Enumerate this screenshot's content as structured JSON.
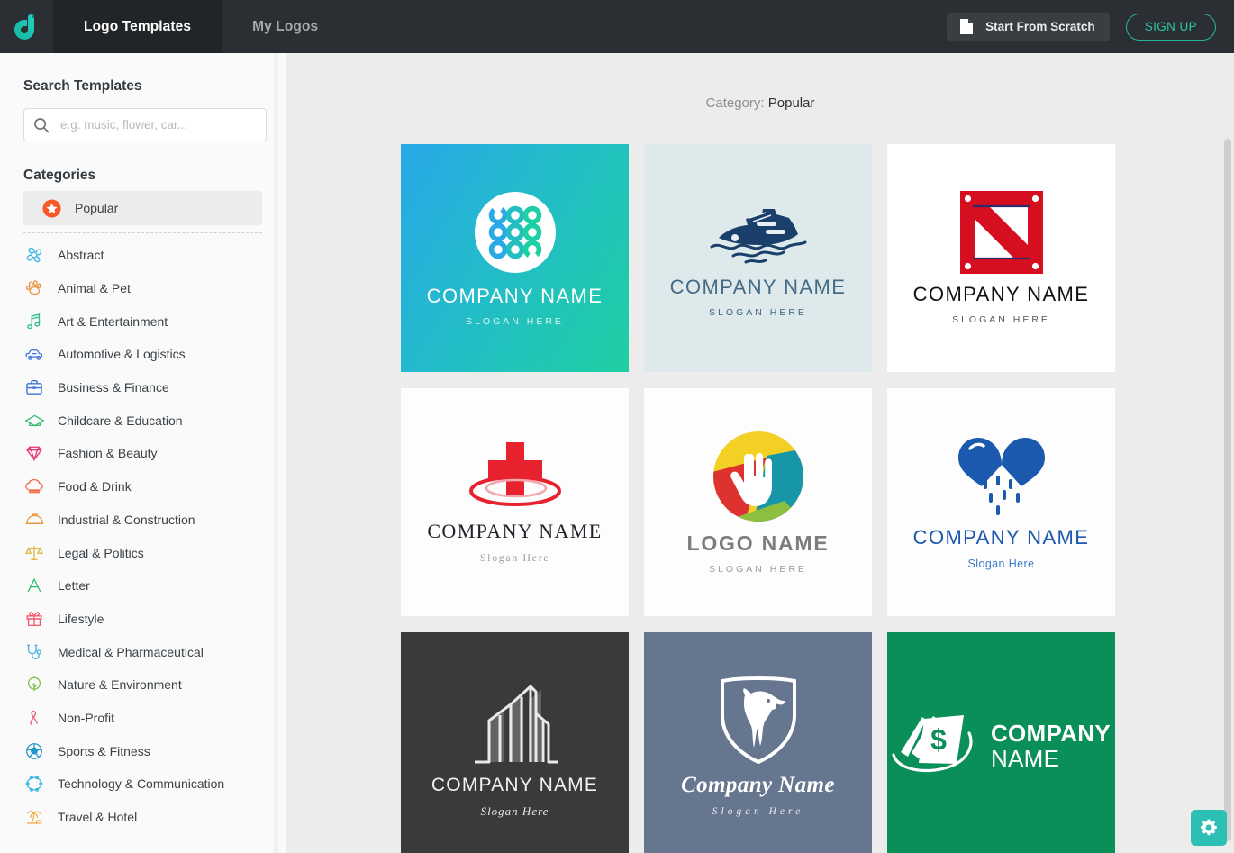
{
  "header": {
    "logo_icon": "brand-d-logo-icon",
    "tabs": [
      {
        "label": "Logo Templates",
        "active": true
      },
      {
        "label": "My Logos",
        "active": false
      }
    ],
    "start_from_scratch": "Start From Scratch",
    "sign_up": "SIGN UP"
  },
  "sidebar": {
    "search_title": "Search Templates",
    "search_placeholder": "e.g. music, flower, car...",
    "search_value": "",
    "categories_title": "Categories",
    "items": [
      {
        "label": "Popular",
        "icon": "star-badge-icon",
        "color": "#f8572a",
        "active": true
      },
      {
        "label": "Abstract",
        "icon": "abstract-swirl-icon",
        "color": "#3fb8e0",
        "active": false
      },
      {
        "label": "Animal & Pet",
        "icon": "paw-icon",
        "color": "#e8933a",
        "active": false
      },
      {
        "label": "Art & Entertainment",
        "icon": "music-note-icon",
        "color": "#2ec28a",
        "active": false
      },
      {
        "label": "Automotive & Logistics",
        "icon": "car-icon",
        "color": "#3c74d8",
        "active": false
      },
      {
        "label": "Business & Finance",
        "icon": "briefcase-icon",
        "color": "#3c74d8",
        "active": false
      },
      {
        "label": "Childcare & Education",
        "icon": "graduation-cap-icon",
        "color": "#2fbd6e",
        "active": false
      },
      {
        "label": "Fashion & Beauty",
        "icon": "diamond-icon",
        "color": "#ea2f73",
        "active": false
      },
      {
        "label": "Food & Drink",
        "icon": "chef-hat-icon",
        "color": "#f2683c",
        "active": false
      },
      {
        "label": "Industrial & Construction",
        "icon": "hard-hat-icon",
        "color": "#e8933a",
        "active": false
      },
      {
        "label": "Legal & Politics",
        "icon": "scales-icon",
        "color": "#e0b53c",
        "active": false
      },
      {
        "label": "Letter",
        "icon": "letter-a-icon",
        "color": "#2fbd6e",
        "active": false
      },
      {
        "label": "Lifestyle",
        "icon": "gift-icon",
        "color": "#f4556a",
        "active": false
      },
      {
        "label": "Medical & Pharmaceutical",
        "icon": "stethoscope-icon",
        "color": "#3fb0e0",
        "active": false
      },
      {
        "label": "Nature & Environment",
        "icon": "tree-icon",
        "color": "#7fc14a",
        "active": false
      },
      {
        "label": "Non-Profit",
        "icon": "ribbon-icon",
        "color": "#ef5d7a",
        "active": false
      },
      {
        "label": "Sports & Fitness",
        "icon": "soccer-ball-icon",
        "color": "#2196c9",
        "active": false
      },
      {
        "label": "Technology & Communication",
        "icon": "tech-hexagon-icon",
        "color": "#3fb8e0",
        "active": false
      },
      {
        "label": "Travel & Hotel",
        "icon": "palm-tree-icon",
        "color": "#f0a93c",
        "active": false
      }
    ]
  },
  "main": {
    "category_label": "Category:",
    "category_value": "Popular",
    "templates": [
      {
        "id": "tpl-dots-circle",
        "mark": "dots-circle-icon",
        "name": "COMPANY NAME",
        "slogan": "SLOGAN HERE",
        "bg": "linear-gradient(120deg,#28a8e8 0%,#23bcc9 45%,#1fcfa2 100%)",
        "name_color": "#ffffff",
        "slogan_color": "#d8f5f2"
      },
      {
        "id": "tpl-cruise-ship",
        "mark": "cruise-ship-icon",
        "name": "COMPANY NAME",
        "slogan": "SLOGAN HERE",
        "bg": "#dde9ea",
        "name_color": "#476b87",
        "slogan_color": "#3d6384"
      },
      {
        "id": "tpl-red-crate-n",
        "mark": "red-crate-n-icon",
        "name": "COMPANY NAME",
        "slogan": "SLOGAN HERE",
        "bg": "#ffffff",
        "name_color": "#111111",
        "slogan_color": "#555555"
      },
      {
        "id": "tpl-red-cross-ripple",
        "mark": "red-cross-ripple-icon",
        "name": "COMPANY NAME",
        "slogan": "Slogan Here",
        "bg": "#fdfdfd",
        "name_color": "#20232a",
        "slogan_color": "#9b9b9b"
      },
      {
        "id": "tpl-hand-circle",
        "mark": "hand-in-circle-icon",
        "name": "LOGO NAME",
        "slogan": "SLOGAN HERE",
        "bg": "#fdfdfd",
        "name_color": "#7d7d7d",
        "slogan_color": "#9b9b9b"
      },
      {
        "id": "tpl-rain-heart",
        "mark": "rain-heart-icon",
        "name": "COMPANY NAME",
        "slogan": "Slogan Here",
        "bg": "#fdfdfd",
        "name_color": "#1a59ad",
        "slogan_color": "#3c7bc8"
      },
      {
        "id": "tpl-buildings",
        "mark": "buildings-outline-icon",
        "name": "COMPANY NAME",
        "slogan": "Slogan Here",
        "bg": "#3a3a3c",
        "name_color": "#f2f2f2",
        "slogan_color": "#e8e8e8"
      },
      {
        "id": "tpl-wolf-shield",
        "mark": "wolf-shield-icon",
        "name": "Company Name",
        "slogan": "Slogan Here",
        "bg": "#66768f",
        "name_color": "#ffffff",
        "slogan_color": "#e9edf3"
      },
      {
        "id": "tpl-money-swoosh",
        "mark": "money-swoosh-icon",
        "name": "COMPANY",
        "slogan": "NAME",
        "bg": "#0b8f59",
        "name_color": "#ffffff",
        "slogan_color": "#ffffff"
      }
    ]
  },
  "footer": {
    "gear_button": "gear-icon",
    "gear_color": "#2cc0b4"
  }
}
